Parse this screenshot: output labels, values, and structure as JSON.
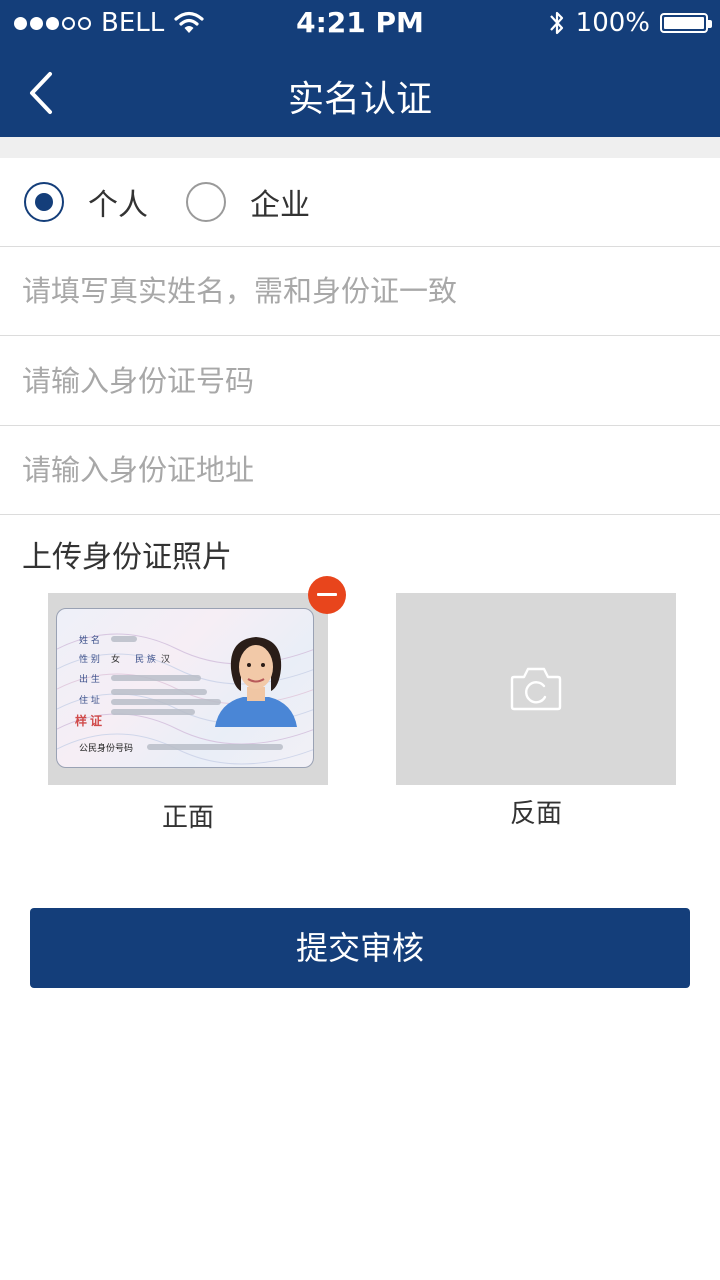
{
  "status_bar": {
    "carrier": "BELL",
    "time": "4:21 PM",
    "battery": "100%",
    "signal_strength": 3,
    "signal_max": 5
  },
  "nav": {
    "back_icon": "chevron-left-icon",
    "title": "实名认证"
  },
  "type_options": [
    {
      "label": "个人",
      "selected": true
    },
    {
      "label": "企业",
      "selected": false
    }
  ],
  "fields": {
    "name": {
      "value": "",
      "placeholder": "请填写真实姓名，需和身份证一致"
    },
    "id_number": {
      "value": "",
      "placeholder": "请输入身份证号码"
    },
    "address": {
      "value": "",
      "placeholder": "请输入身份证地址"
    }
  },
  "upload": {
    "title": "上传身份证照片",
    "front": {
      "caption": "正面",
      "card_labels": {
        "name": "姓 名",
        "gender": "性 别",
        "gender_value": "女",
        "ethnicity": "民 族",
        "ethnicity_value": "汉",
        "birth": "出 生",
        "address": "住 址",
        "id_number": "公民身份号码"
      }
    },
    "back": {
      "caption": "反面",
      "icon": "camera-icon"
    }
  },
  "submit_label": "提交审核",
  "colors": {
    "primary": "#143e7a",
    "remove": "#e8451c",
    "placeholder": "#a8a8a8",
    "divider": "#dcdcdc",
    "section_gap": "#efefef",
    "photo_bg": "#d8d8d8"
  }
}
